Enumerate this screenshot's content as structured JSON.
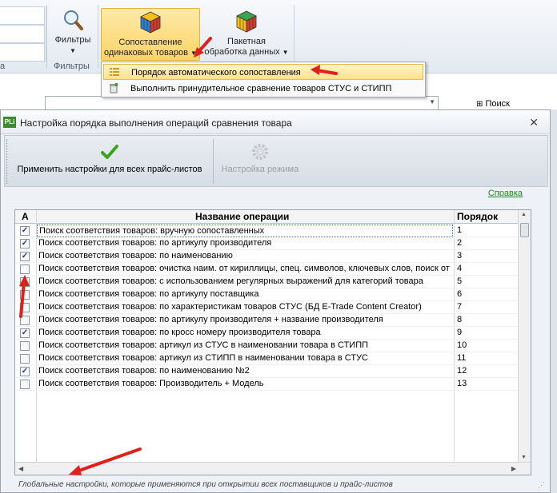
{
  "ribbon": {
    "filters_button_label": "Фильтры",
    "filters_group_label": "Фильтры",
    "left_group_label_fragment": "а",
    "match_button_label_line1": "Сопоставление",
    "match_button_label_line2": "одинаковых товаров",
    "batch_button_label_line1": "Пакетная",
    "batch_button_label_line2": "обработка данных"
  },
  "menu": {
    "items": [
      {
        "label": "Порядок автоматического сопоставления"
      },
      {
        "label": "Выполнить принудительное сравнение товаров СТУС и СТИПП"
      }
    ]
  },
  "background": {
    "search_label": "Поиск"
  },
  "dialog": {
    "app_icon_text": "PLi",
    "title": "Настройка порядка выполнения операций сравнения товара",
    "toolbar": {
      "apply_all_label": "Применить настройки для всех прайс-листов",
      "mode_settings_label": "Настройка режима"
    },
    "help_link": "Справка",
    "grid": {
      "headers": {
        "active": "А",
        "name": "Название операции",
        "order": "Порядок"
      },
      "rows": [
        {
          "checked": true,
          "name": "Поиск соответствия товаров: вручную сопоставленных",
          "order": "1"
        },
        {
          "checked": true,
          "name": "Поиск соответствия товаров: по артикулу производителя",
          "order": "2"
        },
        {
          "checked": true,
          "name": "Поиск соответствия товаров: по наименованию",
          "order": "3"
        },
        {
          "checked": false,
          "name": "Поиск соответствия товаров: очистка наим. от кириллицы, спец. символов, ключевых слов, поиск от",
          "order": "4"
        },
        {
          "checked": false,
          "name": "Поиск соответствия товаров: с использованием регулярных выражений для категорий товара",
          "order": "5"
        },
        {
          "checked": false,
          "name": "Поиск соответствия товаров: по артикулу поставщика",
          "order": "6"
        },
        {
          "checked": false,
          "name": "Поиск соответствия товаров: по характеристикам товаров СТУС (БД E-Trade Content Creator)",
          "order": "7"
        },
        {
          "checked": false,
          "name": "Поиск соответствия товаров: по артикулу производителя + название производителя",
          "order": "8"
        },
        {
          "checked": true,
          "name": "Поиск соответствия товаров: по кросс номеру производителя товара",
          "order": "9"
        },
        {
          "checked": false,
          "name": "Поиск соответствия товаров: артикул из СТУС в наименовании товара в СТИПП",
          "order": "10"
        },
        {
          "checked": false,
          "name": "Поиск соответствия товаров: артикул из СТИПП в наименовании товара в СТУС",
          "order": "11"
        },
        {
          "checked": true,
          "name": "Поиск соответствия товаров: по наименованию №2",
          "order": "12"
        },
        {
          "checked": false,
          "name": "Поиск соответствия товаров: Производитель + Модель",
          "order": "13"
        }
      ],
      "selected_row": 0
    },
    "footer_note": "Глобальные настройки, которые применяются при открытии всех поставщиков и прайс-листов"
  },
  "colors": {
    "accent_button": "#fbd466",
    "help_link": "#1f8a1f",
    "annotation_arrow": "#e0201a",
    "check_mark": "#3aa51a"
  }
}
